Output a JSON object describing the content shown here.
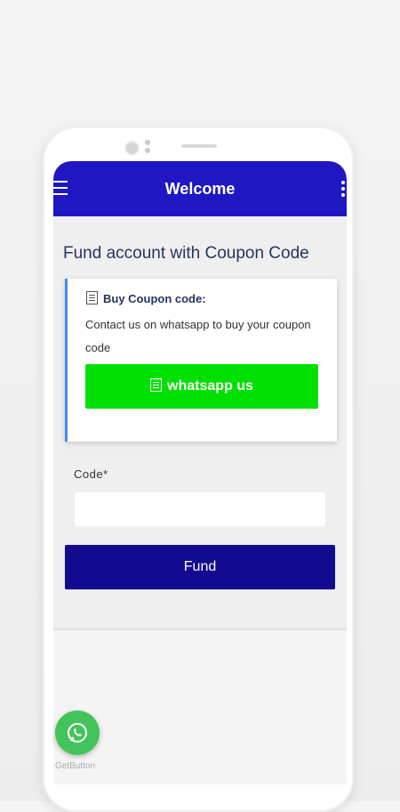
{
  "appbar": {
    "title": "Welcome"
  },
  "page": {
    "title": "Fund account with Coupon Code"
  },
  "card": {
    "heading": "Buy Coupon code:",
    "text": "Contact us on whatsapp to buy your coupon code",
    "button_label": "whatsapp us"
  },
  "form": {
    "code_label": "Code*",
    "code_value": "",
    "submit_label": "Fund"
  },
  "footer": {
    "getbutton_label": "GetButton"
  },
  "colors": {
    "appbar": "#1f17c4",
    "whatsapp_button": "#00e000",
    "fund_button": "#120a8f",
    "card_border": "#3f8ef3",
    "whatsapp_float": "#43c45b"
  },
  "icons": [
    "menu-icon",
    "more-vert-icon",
    "document-icon",
    "whatsapp-icon"
  ]
}
